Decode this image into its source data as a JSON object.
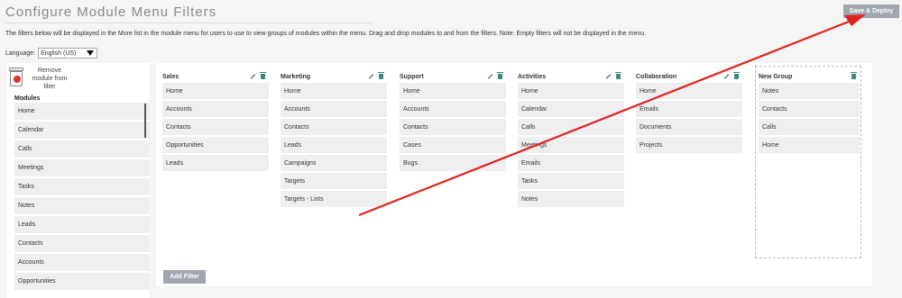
{
  "header": {
    "title": "Configure Module Menu Filters",
    "save_label": "Save & Deploy"
  },
  "description": "The filters below will be displayed in the More list in the module menu for users to use to view groups of modules within the menu. Drag and drop modules to and from the filters. Note: Empty filters will not be displayed in the menu.",
  "language": {
    "label": "Language:",
    "selected": "English (US)"
  },
  "left_panel": {
    "remove_label": "Remove module from filter",
    "modules_title": "Modules",
    "modules": [
      "Home",
      "Calendar",
      "Calls",
      "Meetings",
      "Tasks",
      "Notes",
      "Leads",
      "Contacts",
      "Accounts",
      "Opportunities"
    ]
  },
  "filters": [
    {
      "name": "Sales",
      "items": [
        "Home",
        "Accounts",
        "Contacts",
        "Opportunities",
        "Leads"
      ]
    },
    {
      "name": "Marketing",
      "items": [
        "Home",
        "Accounts",
        "Contacts",
        "Leads",
        "Campaigns",
        "Targets",
        "Targets - Lists"
      ]
    },
    {
      "name": "Support",
      "items": [
        "Home",
        "Accounts",
        "Contacts",
        "Cases",
        "Bugs"
      ]
    },
    {
      "name": "Activities",
      "items": [
        "Home",
        "Calendar",
        "Calls",
        "Meetings",
        "Emails",
        "Tasks",
        "Notes"
      ]
    },
    {
      "name": "Collaboration",
      "items": [
        "Home",
        "Emails",
        "Documents",
        "Projects"
      ]
    }
  ],
  "new_group": {
    "name": "New Group",
    "items": [
      "Notes",
      "Contacts",
      "Calls",
      "Home"
    ]
  },
  "add_filter_label": "Add Filter",
  "colors": {
    "button_bg": "#a0a6ae",
    "item_bg": "#efefef",
    "annotation_arrow": "#e0231d"
  },
  "icons": [
    "trash-icon",
    "pencil-icon",
    "trash-small-icon",
    "dropdown-caret-icon",
    "annotation-arrow"
  ]
}
